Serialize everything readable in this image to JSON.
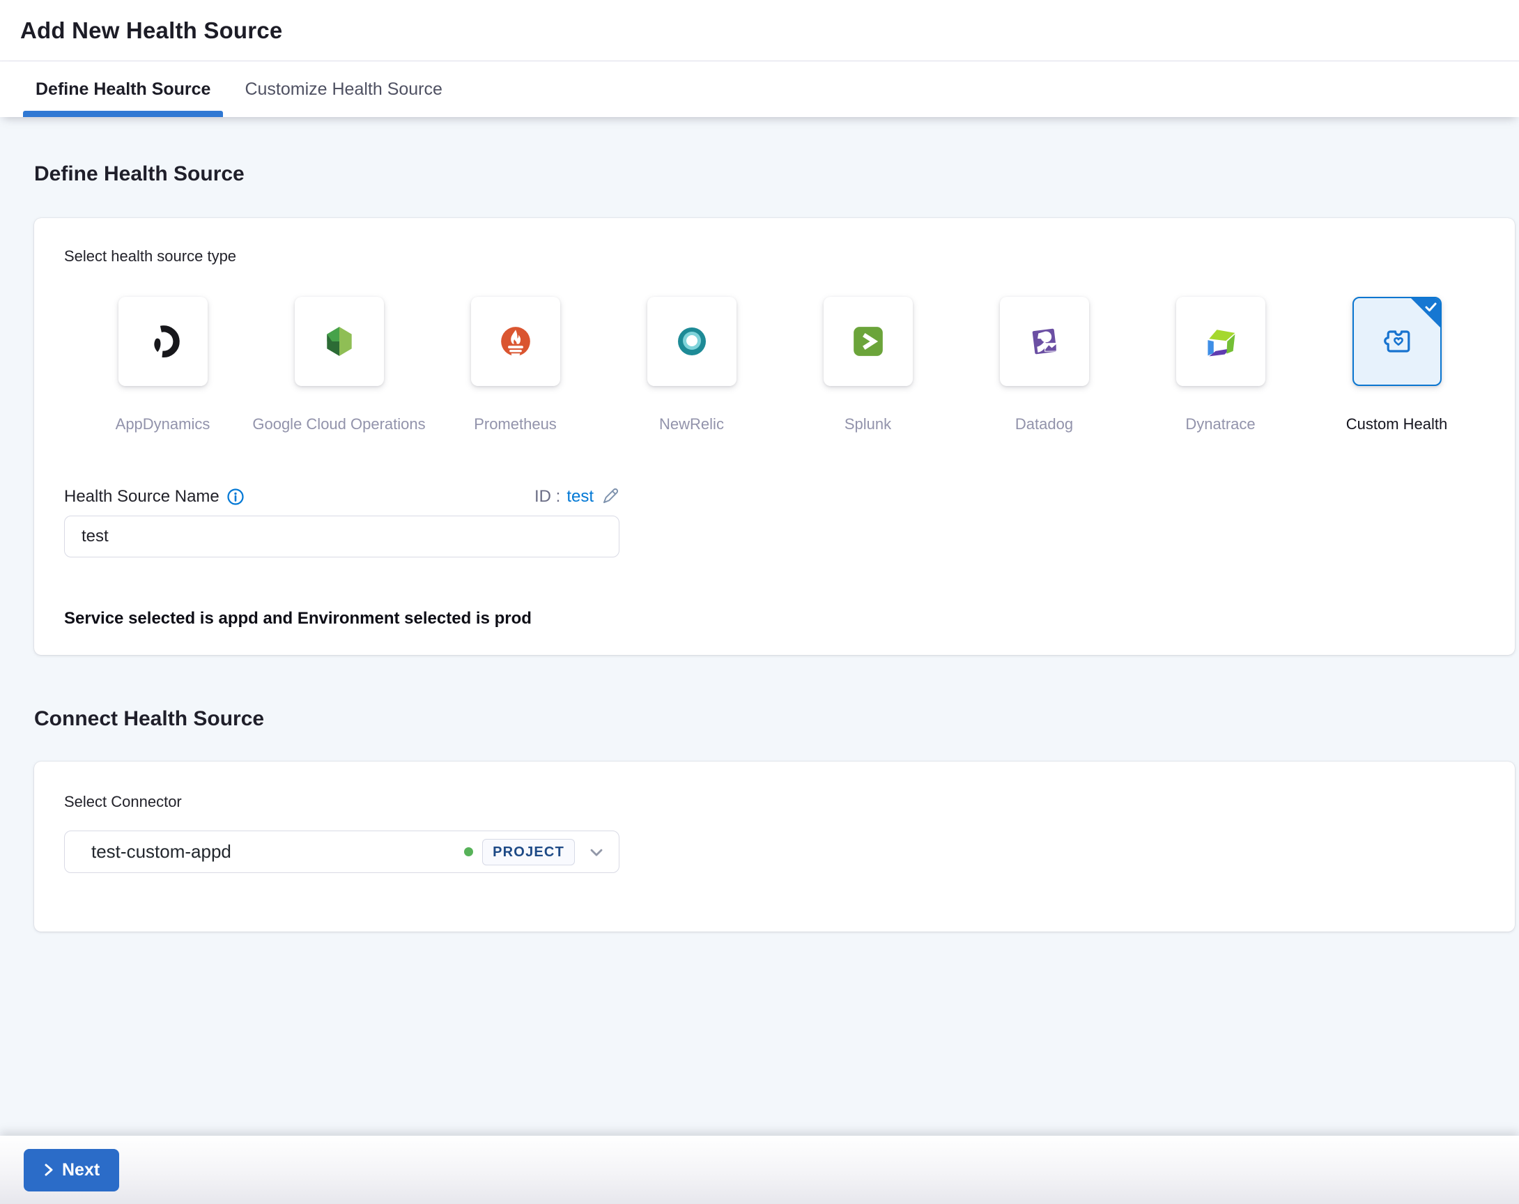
{
  "header": {
    "title": "Add New Health Source"
  },
  "tabs": [
    {
      "label": "Define Health Source",
      "active": true
    },
    {
      "label": "Customize Health Source",
      "active": false
    }
  ],
  "define_section": {
    "heading": "Define Health Source",
    "select_type_label": "Select health source type",
    "source_types": [
      {
        "name": "AppDynamics",
        "icon": "appdynamics-icon",
        "selected": false
      },
      {
        "name": "Google Cloud Operations",
        "icon": "google-cloud-operations-icon",
        "selected": false
      },
      {
        "name": "Prometheus",
        "icon": "prometheus-icon",
        "selected": false
      },
      {
        "name": "NewRelic",
        "icon": "newrelic-icon",
        "selected": false
      },
      {
        "name": "Splunk",
        "icon": "splunk-icon",
        "selected": false
      },
      {
        "name": "Datadog",
        "icon": "datadog-icon",
        "selected": false
      },
      {
        "name": "Dynatrace",
        "icon": "dynatrace-icon",
        "selected": false
      },
      {
        "name": "Custom Health",
        "icon": "custom-health-icon",
        "selected": true
      }
    ],
    "name_label": "Health Source Name",
    "name_info_icon": "info-icon",
    "id_label": "ID :",
    "id_value": "test",
    "id_edit_icon": "edit-pencil-icon",
    "name_value": "test",
    "service_env_text": "Service selected is appd and Environment selected is prod"
  },
  "connect_section": {
    "heading": "Connect Health Source",
    "connector_label": "Select Connector",
    "connector_value": "test-custom-appd",
    "connector_status_icon": "green-status-dot",
    "connector_scope": "PROJECT",
    "connector_caret_icon": "chevron-down-icon"
  },
  "footer": {
    "next_label": "Next",
    "next_icon": "chevron-right-icon"
  },
  "colors": {
    "accent_link": "#0278d5",
    "tab_underline": "#2f78d3",
    "next_button": "#2b6cc8",
    "selected_tile_border": "#0b76d0",
    "selected_tile_bg": "#e7f2fc",
    "status_green": "#57b259",
    "badge_text": "#1e4a86",
    "page_bg": "#f3f7fb",
    "muted_label": "#9293ab"
  }
}
